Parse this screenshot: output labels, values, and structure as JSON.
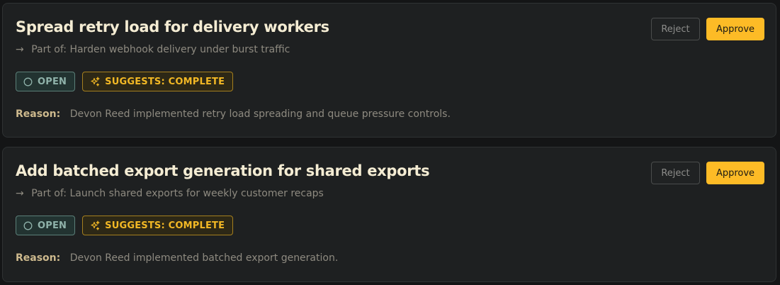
{
  "colors": {
    "page_bg": "#141516",
    "card_bg": "#1e2021",
    "title": "#f4ecd3",
    "muted": "#8e8a80",
    "reason_label": "#cdb98d",
    "open_badge": "#8fb2aa",
    "suggest_badge": "#f2b825",
    "approve_bg": "#fdbb26"
  },
  "cards": [
    {
      "title": "Spread retry load for delivery workers",
      "parent_prefix": "Part of:",
      "parent_name": "Harden webhook delivery under burst traffic",
      "status_badge": "OPEN",
      "suggestion_badge": "SUGGESTS: COMPLETE",
      "reason_label": "Reason:",
      "reason_text": "Devon Reed implemented retry load spreading and queue pressure controls.",
      "reject_label": "Reject",
      "approve_label": "Approve"
    },
    {
      "title": "Add batched export generation for shared exports",
      "parent_prefix": "Part of:",
      "parent_name": "Launch shared exports for weekly customer recaps",
      "status_badge": "OPEN",
      "suggestion_badge": "SUGGESTS: COMPLETE",
      "reason_label": "Reason:",
      "reason_text": "Devon Reed implemented batched export generation.",
      "reject_label": "Reject",
      "approve_label": "Approve"
    }
  ],
  "icons": {
    "parent_arrow": "arrow-right-icon",
    "status": "circle-icon",
    "suggestion": "sparkles-icon"
  }
}
